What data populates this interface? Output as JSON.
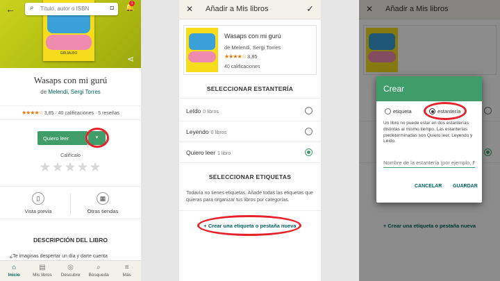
{
  "panel1": {
    "search_placeholder": "Título, autor o ISBN",
    "notification_count": "1",
    "cover_brand": "GRIJALBO",
    "book_title": "Wasaps con mi gurú",
    "author_prefix": "de",
    "authors": "Melendi, Sergi Torres",
    "rating_value": "3,85",
    "rating_counts": "· 40 calificaciones · 5 reseñas",
    "want_button": "Quiero leer",
    "rate_label": "Califícalo",
    "action_preview": "Vista previa",
    "action_stores": "Otras tiendas",
    "description_heading": "DESCRIPCIÓN DEL LIBRO",
    "description_start": "¿Te imaginas despertar un día y darte cuenta",
    "tabs": [
      {
        "label": "Inicio",
        "icon": "home-icon",
        "glyph": "⌂"
      },
      {
        "label": "Mis libros",
        "icon": "book-icon",
        "glyph": "▤"
      },
      {
        "label": "Descubre",
        "icon": "compass-icon",
        "glyph": "◎"
      },
      {
        "label": "Búsqueda",
        "icon": "search-icon",
        "glyph": "⌕"
      },
      {
        "label": "Más",
        "icon": "menu-icon",
        "glyph": "≡"
      }
    ]
  },
  "panel2": {
    "title": "Añadir a Mis libros",
    "book_title": "Wasaps con mi gurú",
    "authors": "de Melendi, Sergi Torres",
    "rating_value": "3,85",
    "ratings_count": "40 calificaciones",
    "shelf_heading": "SELECCIONAR ESTANTERÍA",
    "shelves": [
      {
        "name": "Leído",
        "count": "0 libros",
        "selected": false
      },
      {
        "name": "Leyendo",
        "count": "0 libros",
        "selected": false
      },
      {
        "name": "Quiero leer",
        "count": "1 libro",
        "selected": true
      }
    ],
    "tags_heading": "SELECCIONAR ETIQUETAS",
    "tags_text": "Todavía no tienes etiquetas. Añade todas las etiquetas que quieras para organizar tus libros por categorías.",
    "create_link": "+ Crear una etiqueta o pestaña nueva"
  },
  "panel3": {
    "dialog_title": "Crear",
    "option_tag": "etiqueta",
    "option_shelf": "estantería",
    "dialog_text": "Un libro no puede estar en dos estanterías distintas al mismo tiempo. Las estanterías predeterminadas son Quiero leer, Leyendo y Leído.",
    "input_placeholder": "Nombre de la estantería (por ejemplo, Favoritos)",
    "cancel": "CANCELAR",
    "save": "GUARDAR"
  },
  "colors": {
    "accent_green": "#409d69",
    "highlight_red": "#e8222a",
    "link_teal": "#00635d",
    "star_orange": "#e87400"
  }
}
